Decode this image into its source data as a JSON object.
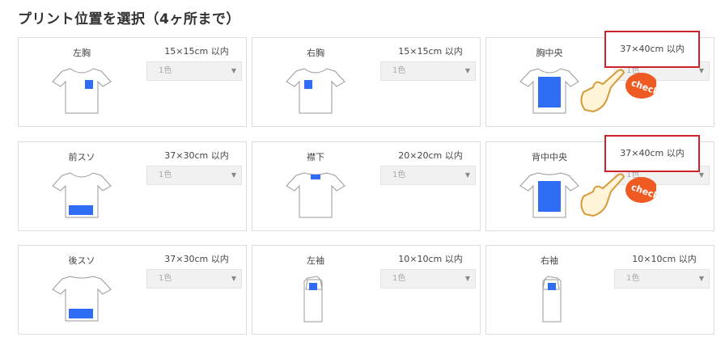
{
  "page_title": "プリント位置を選択（4ヶ所まで）",
  "colors": {
    "print_area": "#2f6df6",
    "highlight_border": "#cc2229",
    "badge": "#ef5a23"
  },
  "options": [
    {
      "name": "左胸",
      "size": "15×15cm 以内",
      "select_value": "1色",
      "mark": "left-chest",
      "highlighted": false
    },
    {
      "name": "右胸",
      "size": "15×15cm 以内",
      "select_value": "1色",
      "mark": "right-chest",
      "highlighted": false
    },
    {
      "name": "胸中央",
      "size": "37×40cm 以内",
      "select_value": "1色",
      "mark": "chest-center",
      "highlighted": true
    },
    {
      "name": "前スソ",
      "size": "37×30cm 以内",
      "select_value": "1色",
      "mark": "front-hem",
      "highlighted": false
    },
    {
      "name": "襟下",
      "size": "20×20cm 以内",
      "select_value": "1色",
      "mark": "under-collar",
      "highlighted": false
    },
    {
      "name": "背中中央",
      "size": "37×40cm 以内",
      "select_value": "1色",
      "mark": "back-center",
      "highlighted": true
    },
    {
      "name": "後スソ",
      "size": "37×30cm 以内",
      "select_value": "1色",
      "mark": "back-hem",
      "highlighted": false
    },
    {
      "name": "左袖",
      "size": "10×10cm 以内",
      "select_value": "1色",
      "mark": "left-sleeve",
      "highlighted": false
    },
    {
      "name": "右袖",
      "size": "10×10cm 以内",
      "select_value": "1色",
      "mark": "right-sleeve",
      "highlighted": false
    }
  ],
  "badge_text": "check"
}
